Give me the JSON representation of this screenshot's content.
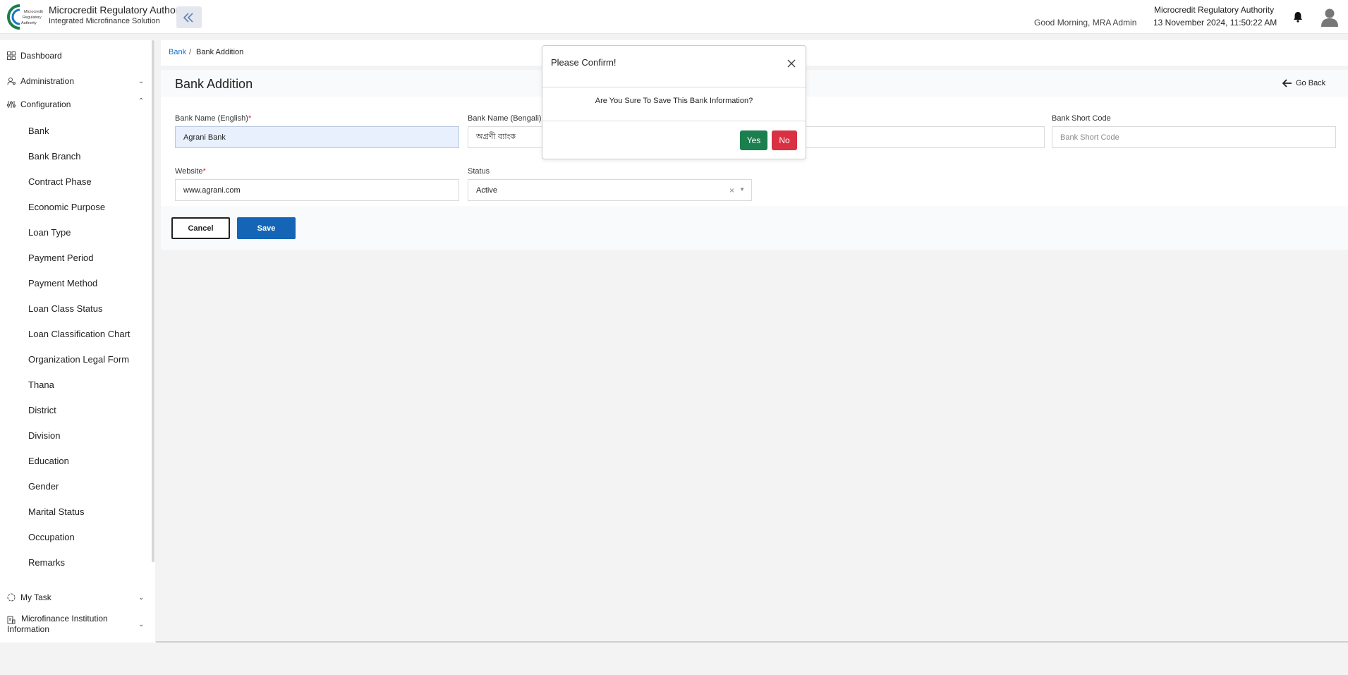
{
  "header": {
    "app_title": "Microcredit Regulatory Authority",
    "app_subtitle": "Integrated Microfinance Solution",
    "logo_lines": [
      "Microcredit",
      "Regulatory",
      "Authority"
    ],
    "greeting": "Good Morning, MRA Admin",
    "org_name": "Microcredit Regulatory Authority",
    "datetime": "13 November 2024, 11:50:22 AM",
    "icons": {
      "collapse": "double-chevron-left-icon",
      "bell": "bell-icon",
      "avatar": "user-avatar-icon"
    }
  },
  "sidebar": {
    "top_items": [
      {
        "label": "Dashboard",
        "icon": "grid-icon"
      },
      {
        "label": "Administration",
        "icon": "users-cog-icon"
      },
      {
        "label": "Configuration",
        "icon": "sliders-icon"
      }
    ],
    "config_items": [
      "Bank",
      "Bank Branch",
      "Contract Phase",
      "Economic Purpose",
      "Loan Type",
      "Payment Period",
      "Payment Method",
      "Loan Class Status",
      "Loan Classification Chart",
      "Organization Legal Form",
      "Thana",
      "District",
      "Division",
      "Education",
      "Gender",
      "Marital Status",
      "Occupation",
      "Remarks"
    ],
    "bottom_items": [
      {
        "label": "My Task",
        "icon": "task-icon"
      },
      {
        "label": "Microfinance Institution Information",
        "icon": "building-doc-icon"
      }
    ]
  },
  "breadcrumb": {
    "link": "Bank",
    "separator": "/",
    "current": "Bank Addition"
  },
  "page": {
    "title": "Bank Addition",
    "go_back": "Go Back"
  },
  "form": {
    "bank_name_en": {
      "label": "Bank Name (English)",
      "required": "*",
      "value": "Agrani Bank"
    },
    "bank_name_bn": {
      "label": "Bank Name (Bengali)",
      "required": "*",
      "value": "অগ্রণী ব্যাংক"
    },
    "bank_short_code": {
      "label": "Bank Short Code",
      "placeholder": "Bank Short Code"
    },
    "website": {
      "label": "Website",
      "required": "*",
      "value": "www.agrani.com"
    },
    "status": {
      "label": "Status",
      "value": "Active",
      "clear": "×",
      "caret": "▼"
    },
    "cancel_label": "Cancel",
    "save_label": "Save"
  },
  "modal": {
    "title": "Please Confirm!",
    "message": "Are You Sure To Save This Bank Information?",
    "yes_label": "Yes",
    "no_label": "No"
  },
  "colors": {
    "primary": "#1565b6",
    "link": "#1a73c9",
    "yes": "#1b7f4f",
    "no": "#d93042",
    "required": "#d32f2f"
  }
}
